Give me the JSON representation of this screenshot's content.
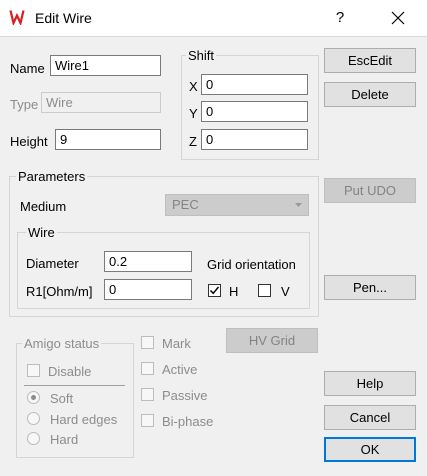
{
  "window": {
    "title": "Edit Wire",
    "help_glyph": "?"
  },
  "name": {
    "label": "Name",
    "value": "Wire1"
  },
  "type": {
    "label": "Type",
    "value": "Wire"
  },
  "height": {
    "label": "Height",
    "value": "9"
  },
  "shift": {
    "title": "Shift",
    "x": {
      "label": "X",
      "value": "0"
    },
    "y": {
      "label": "Y",
      "value": "0"
    },
    "z": {
      "label": "Z",
      "value": "0"
    }
  },
  "buttons": {
    "escedit": "EscEdit",
    "delete": "Delete",
    "put_udo": "Put UDO",
    "pen": "Pen...",
    "hv_grid": "HV Grid",
    "help": "Help",
    "cancel": "Cancel",
    "ok": "OK"
  },
  "parameters": {
    "title": "Parameters",
    "medium": {
      "label": "Medium",
      "selected": "PEC"
    },
    "wire": {
      "title": "Wire",
      "diameter": {
        "label": "Diameter",
        "value": "0.2"
      },
      "r1": {
        "label": "R1[Ohm/m]",
        "value": "0"
      },
      "grid_orientation": {
        "label": "Grid orientation",
        "h": {
          "label": "H",
          "checked": true
        },
        "v": {
          "label": "V",
          "checked": false
        }
      }
    }
  },
  "amigo": {
    "title": "Amigo status",
    "disable": "Disable",
    "options": [
      "Soft",
      "Hard edges",
      "Hard"
    ],
    "selected": "Soft"
  },
  "flags": [
    "Mark",
    "Active",
    "Passive",
    "Bi-phase"
  ],
  "colors": {
    "app_icon": "#d81e1e",
    "default_button_border": "#0078d7"
  }
}
